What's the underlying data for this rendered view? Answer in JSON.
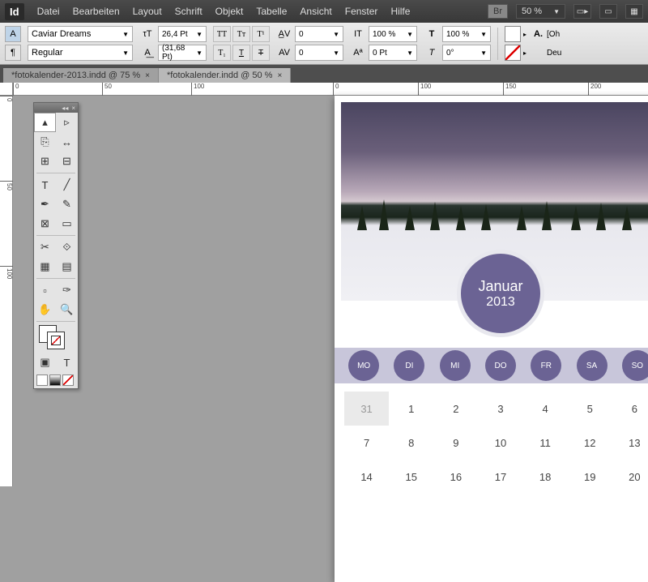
{
  "menubar": {
    "items": [
      "Datei",
      "Bearbeiten",
      "Layout",
      "Schrift",
      "Objekt",
      "Tabelle",
      "Ansicht",
      "Fenster",
      "Hilfe"
    ],
    "br": "Br",
    "zoom": "50 %"
  },
  "control": {
    "font": "Caviar Dreams",
    "style": "Regular",
    "size": "26,4 Pt",
    "leading": "(31,68 Pt)",
    "kerning": "0",
    "tracking": "0",
    "vscale": "100 %",
    "hscale": "100 %",
    "baseline": "0 Pt",
    "skew": "0°",
    "lang": "Deu",
    "oh": "[Oh"
  },
  "tabs": [
    {
      "label": "*fotokalender-2013.indd @ 75 %",
      "active": true
    },
    {
      "label": "*fotokalender.indd @ 50 %",
      "active": false
    }
  ],
  "ruler_h": [
    "0",
    "50",
    "100",
    "50",
    "100",
    "150",
    "200"
  ],
  "ruler_v": [
    "0",
    "50",
    "100"
  ],
  "calendar": {
    "month": "Januar",
    "year": "2013",
    "days": [
      "MO",
      "DI",
      "MI",
      "DO",
      "FR",
      "SA",
      "SO"
    ],
    "grid": [
      {
        "n": "31",
        "prev": true
      },
      {
        "n": "1"
      },
      {
        "n": "2"
      },
      {
        "n": "3"
      },
      {
        "n": "4"
      },
      {
        "n": "5"
      },
      {
        "n": "6"
      },
      {
        "n": "7"
      },
      {
        "n": "8"
      },
      {
        "n": "9"
      },
      {
        "n": "10"
      },
      {
        "n": "11"
      },
      {
        "n": "12"
      },
      {
        "n": "13"
      },
      {
        "n": "14"
      },
      {
        "n": "15"
      },
      {
        "n": "16"
      },
      {
        "n": "17"
      },
      {
        "n": "18"
      },
      {
        "n": "19"
      },
      {
        "n": "20"
      }
    ]
  }
}
